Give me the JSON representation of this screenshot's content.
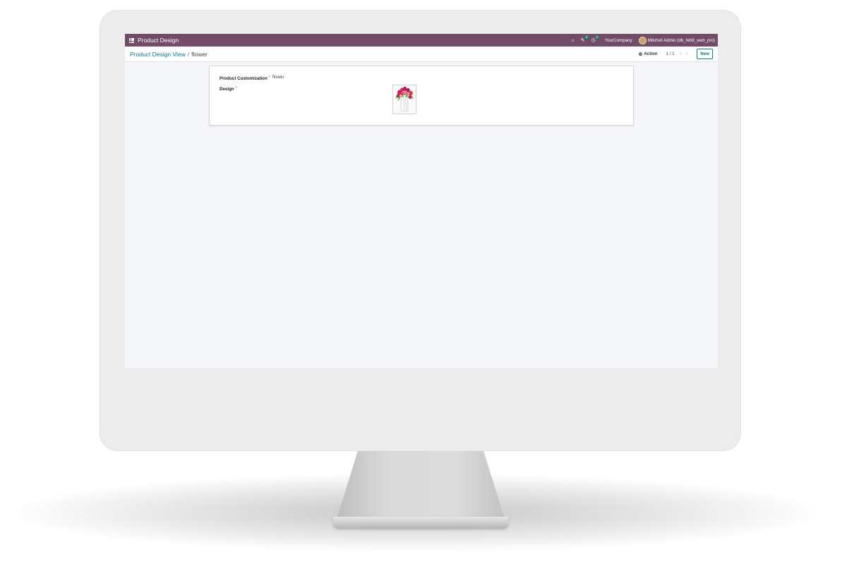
{
  "navbar": {
    "app_name": "Product Design",
    "messages_count": "4",
    "activities_count": "2",
    "company": "YourCompany",
    "user": "Mitchell Admin (db_feb8_web_pro)"
  },
  "control_panel": {
    "breadcrumb_parent": "Product Design View",
    "breadcrumb_separator": "/",
    "breadcrumb_current": "flower",
    "action_label": "Action",
    "pager": "1 / 1",
    "new_label": "New"
  },
  "form": {
    "customization_label": "Product Customization",
    "customization_help": "?",
    "customization_value": "flower",
    "design_label": "Design",
    "design_help": "?"
  },
  "colors": {
    "navbar": "#714b67",
    "accent": "#017e84"
  },
  "icons": {
    "apps": "grid-icon",
    "home": "home-icon",
    "messages": "chat-icon",
    "activities": "clock-icon",
    "action": "gear-icon",
    "prev": "chevron-left-icon",
    "next": "chevron-right-icon"
  }
}
